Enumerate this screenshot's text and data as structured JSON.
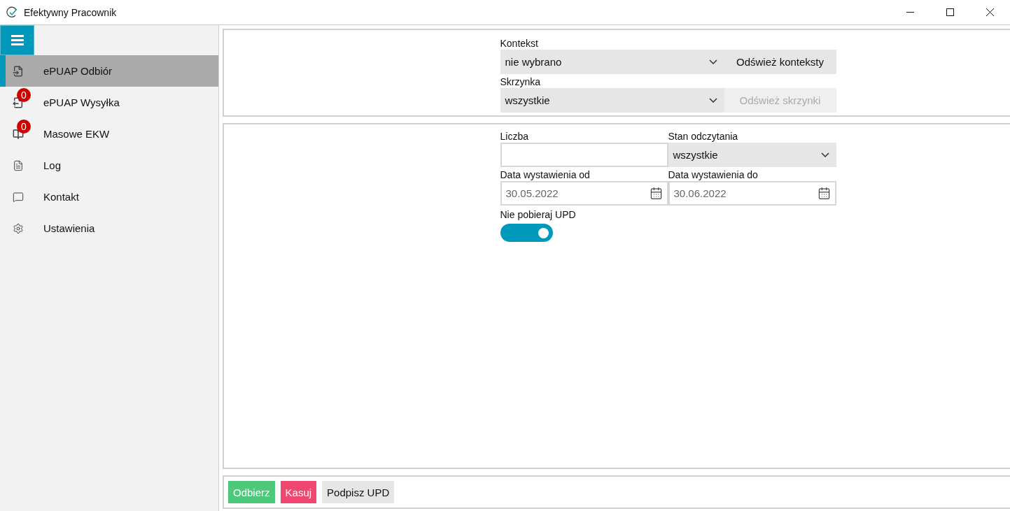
{
  "window": {
    "title": "Efektywny Pracownik"
  },
  "sidebar": {
    "items": [
      {
        "label": "ePUAP Odbiór",
        "selected": true
      },
      {
        "label": "ePUAP Wysyłka",
        "selected": false,
        "badge": "0"
      },
      {
        "label": "Masowe EKW",
        "selected": false,
        "badge": "0"
      },
      {
        "label": "Log",
        "selected": false
      },
      {
        "label": "Kontakt",
        "selected": false
      },
      {
        "label": "Ustawienia",
        "selected": false
      }
    ]
  },
  "context_panel": {
    "rows": [
      {
        "label": "Kontekst",
        "value": "nie wybrano",
        "button": {
          "label": "Odśwież konteksty",
          "disabled": false
        }
      },
      {
        "label": "Skrzynka",
        "value": "wszystkie",
        "button": {
          "label": "Odśwież skrzynki",
          "disabled": true
        }
      }
    ]
  },
  "filters": {
    "count": {
      "label": "Liczba"
    },
    "read_state": {
      "label": "Stan odczytania",
      "value": "wszystkie"
    },
    "date_from": {
      "label": "Data wystawienia od",
      "value": "30.05.2022"
    },
    "date_to": {
      "label": "Data wystawienia do",
      "value": "30.06.2022"
    },
    "skip_upd": {
      "label": "Nie pobieraj UPD",
      "on": true
    }
  },
  "actions": [
    {
      "label": "Odbierz",
      "kind": "primary"
    },
    {
      "label": "Kasuj",
      "kind": "danger"
    },
    {
      "label": "Podpisz UPD",
      "kind": "default"
    }
  ]
}
